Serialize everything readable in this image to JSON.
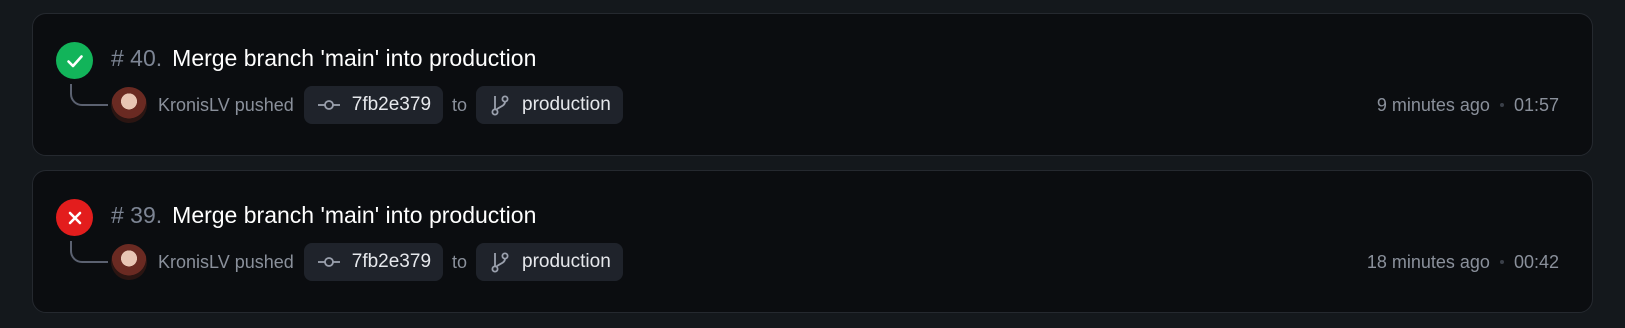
{
  "runs": [
    {
      "status": "success",
      "status_icon": "check-icon",
      "number": "# 40.",
      "title": "Merge branch 'main' into production",
      "user": "KronisLV pushed",
      "commit": "7fb2e379",
      "to_label": "to",
      "branch": "production",
      "time_ago": "9 minutes ago",
      "duration": "01:57"
    },
    {
      "status": "failure",
      "status_icon": "x-icon",
      "number": "# 39.",
      "title": "Merge branch 'main' into production",
      "user": "KronisLV pushed",
      "commit": "7fb2e379",
      "to_label": "to",
      "branch": "production",
      "time_ago": "18 minutes ago",
      "duration": "00:42"
    }
  ],
  "colors": {
    "success": "#12b45a",
    "failure": "#e31d1d",
    "background": "#14181c",
    "card": "#0b0d10"
  }
}
